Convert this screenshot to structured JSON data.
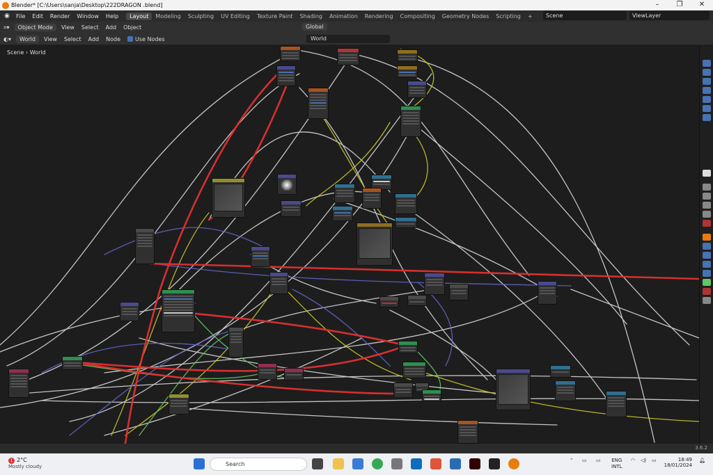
{
  "window": {
    "title": "Blender* [C:\\Users\\sanja\\Desktop\\222DRAGON .blend]"
  },
  "menu": [
    "File",
    "Edit",
    "Render",
    "Window",
    "Help"
  ],
  "workspaces": [
    "Layout",
    "Modeling",
    "Sculpting",
    "UV Editing",
    "Texture Paint",
    "Shading",
    "Animation",
    "Rendering",
    "Compositing",
    "Geometry Nodes",
    "Scripting"
  ],
  "active_workspace": "Layout",
  "scene": {
    "name": "Scene",
    "view_layer": "ViewLayer"
  },
  "header1": {
    "mode": "Object Mode",
    "view": "View",
    "select": "Select",
    "add": "Add",
    "object": "Object",
    "orientation": "Global"
  },
  "header2": {
    "shader_type": "World",
    "view": "View",
    "select": "Select",
    "add": "Add",
    "node": "Node",
    "use_nodes": "Use Nodes",
    "world_name": "World"
  },
  "breadcrumb": {
    "scene": "Scene",
    "world": "World"
  },
  "status": {
    "version": "3.6.2"
  },
  "taskbar": {
    "weather_temp": "2°C",
    "weather_desc": "Mostly cloudy",
    "search_placeholder": "Search",
    "lang": "ENG",
    "layout": "INTL",
    "time": "18:49",
    "date": "18/01/2024",
    "weather_badge": "1"
  },
  "colors": {
    "wire_red": "#e03030",
    "wire_white": "#d8d8d8",
    "wire_yellow": "#c7c729",
    "wire_purple": "#6363c7",
    "wire_green": "#63c763",
    "accent": "#4772b3"
  }
}
